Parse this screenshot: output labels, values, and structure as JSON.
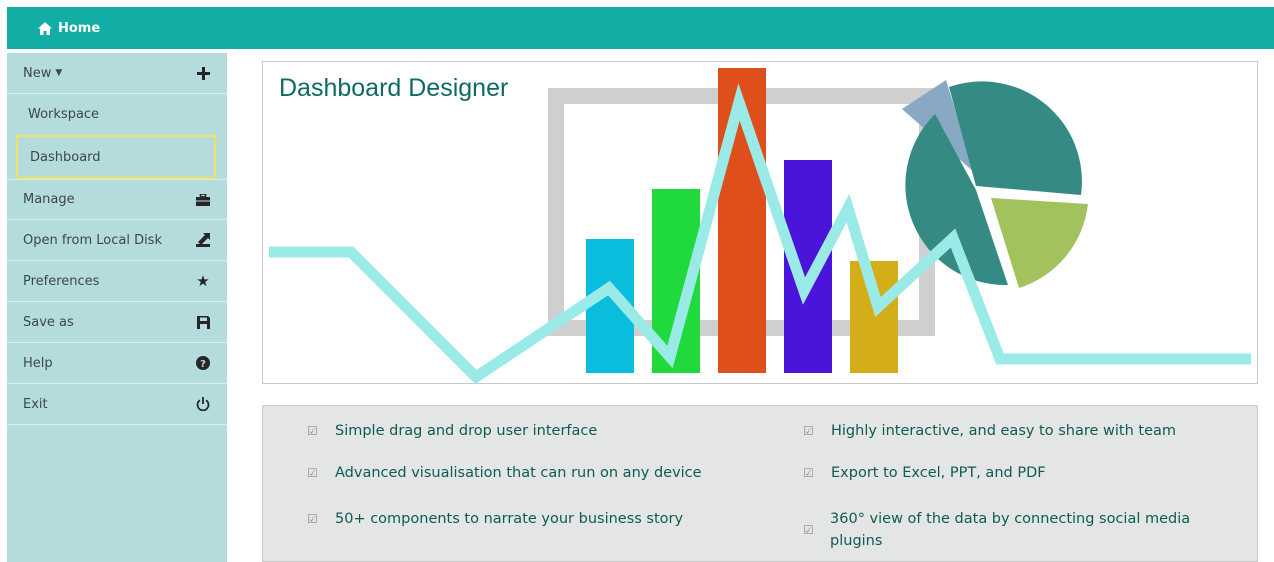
{
  "topbar": {
    "home_label": "Home"
  },
  "sidebar": {
    "items": [
      {
        "label": "New",
        "icon": "plus-icon"
      },
      {
        "label": "Workspace"
      },
      {
        "label": "Dashboard"
      },
      {
        "label": "Manage",
        "icon": "briefcase-icon"
      },
      {
        "label": "Open from Local Disk",
        "icon": "upload-icon"
      },
      {
        "label": "Preferences",
        "icon": "star-icon"
      },
      {
        "label": "Save as",
        "icon": "save-icon"
      },
      {
        "label": "Help",
        "icon": "question-icon"
      },
      {
        "label": "Exit",
        "icon": "power-icon"
      }
    ]
  },
  "hero": {
    "title": "Dashboard Designer"
  },
  "features": {
    "left": [
      "Simple drag and drop user interface",
      "Advanced visualisation that can run on any device",
      "50+ components to narrate your business story"
    ],
    "right": [
      "Highly interactive, and easy to share with team",
      "Export to Excel, PPT, and PDF",
      "360° view of the data by connecting social media plugins"
    ]
  },
  "colors": {
    "topbar": "#12ada5",
    "sidebar": "#b4dcdc",
    "selected_border": "#f2e35b",
    "title": "#0f6a64"
  }
}
